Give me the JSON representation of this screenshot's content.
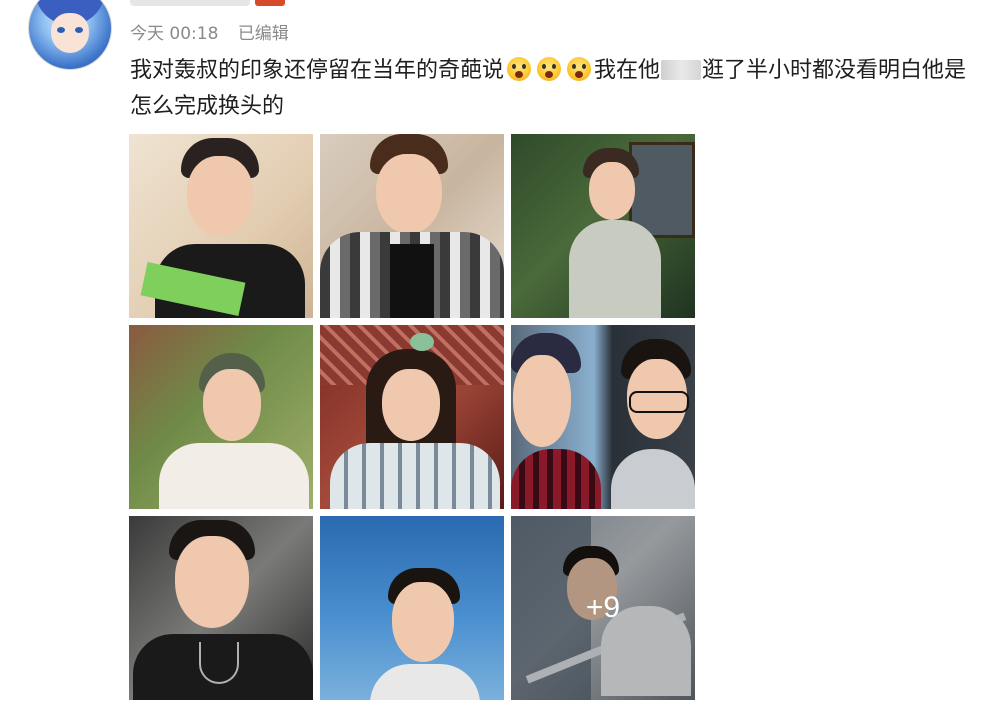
{
  "post": {
    "time": "今天 00:18",
    "edited": "已编辑",
    "text_part1": "我对轰叔的印象还停留在当年的奇葩说",
    "text_part2": "我在他",
    "text_part3": "逛了半小时都没看明白他是怎么完成换头的",
    "emoji_count": 3,
    "emoji_icon": "screaming-face-icon"
  },
  "photos": {
    "count_shown": 9,
    "more_label": "+9"
  }
}
